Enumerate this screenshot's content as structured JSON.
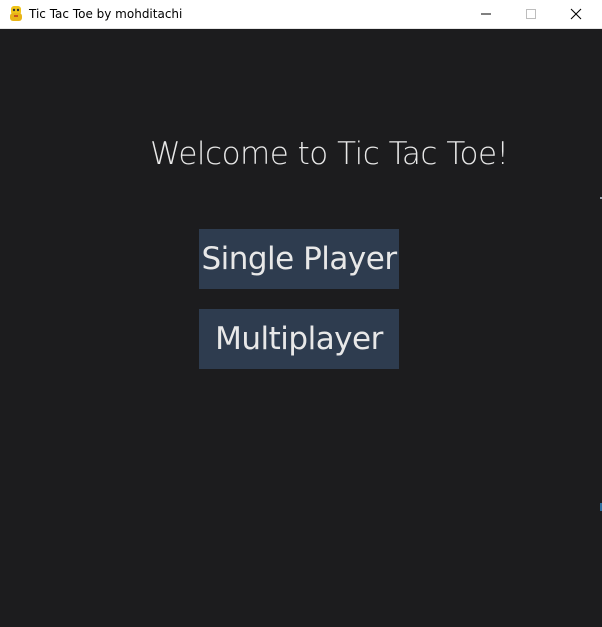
{
  "window": {
    "title": "Tic Tac Toe by mohditachi",
    "app_icon": "python-snake-icon",
    "controls": {
      "minimize_icon": "minimize-icon",
      "maximize_icon": "maximize-icon",
      "close_icon": "close-icon"
    }
  },
  "main": {
    "welcome_text": "Welcome to Tic Tac Toe!",
    "buttons": {
      "single_player": "Single Player",
      "multiplayer": "Multiplayer"
    }
  },
  "colors": {
    "background": "#1c1c1e",
    "button_bg": "#2e3c4f",
    "text": "#e8e8e8",
    "titlebar": "#ffffff"
  }
}
